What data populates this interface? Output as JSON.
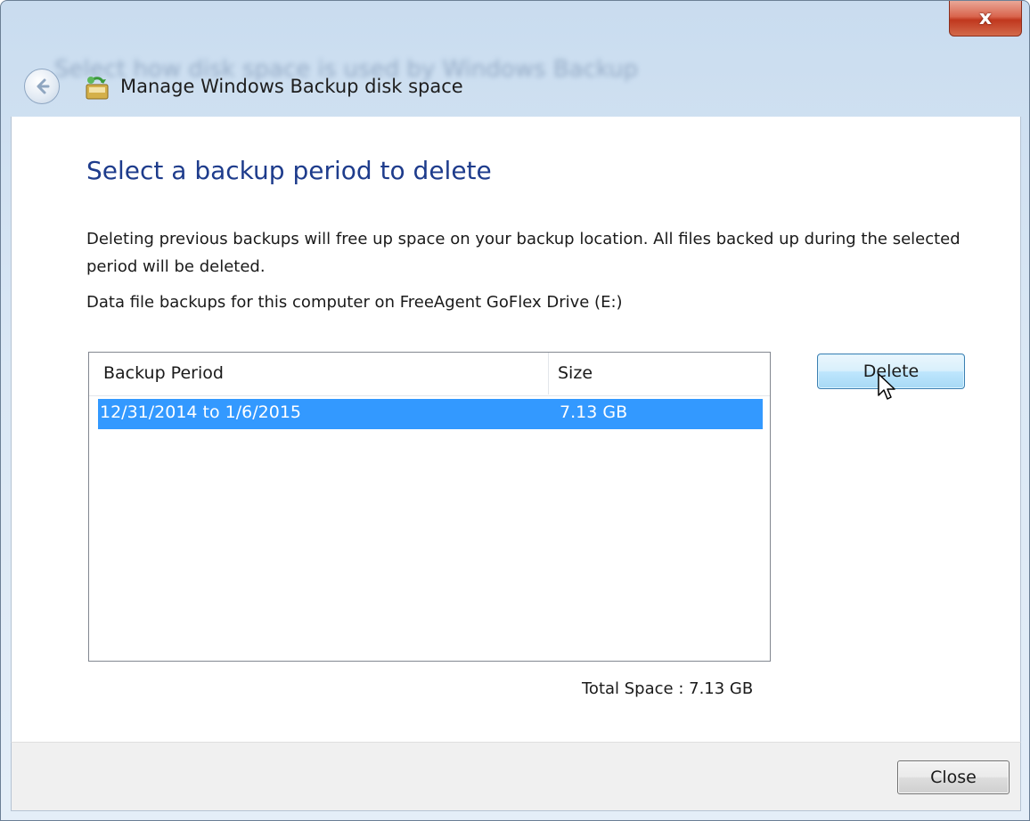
{
  "window": {
    "title": "Manage Windows Backup disk space",
    "blurred_background_text": "Select how disk space is used by Windows Backup",
    "close_glyph": "x",
    "accent_color": "#1e3c8c",
    "selection_color": "#3399ff"
  },
  "icons": {
    "back": "back-arrow-icon",
    "app": "backup-icon",
    "close": "close-icon",
    "cursor": "mouse-pointer-icon"
  },
  "main": {
    "heading": "Select a backup period to delete",
    "description": "Deleting previous backups will free up space on your backup location. All files backed up during the selected period will be deleted.",
    "location_label": "Data file backups for this computer on FreeAgent GoFlex Drive (E:)",
    "table": {
      "columns": [
        "Backup Period",
        "Size"
      ],
      "rows": [
        {
          "period": "12/31/2014 to 1/6/2015",
          "size": "7.13 GB",
          "selected": true
        }
      ]
    },
    "delete_label": "Delete",
    "total_space": "Total Space : 7.13 GB"
  },
  "footer": {
    "close_label": "Close"
  }
}
